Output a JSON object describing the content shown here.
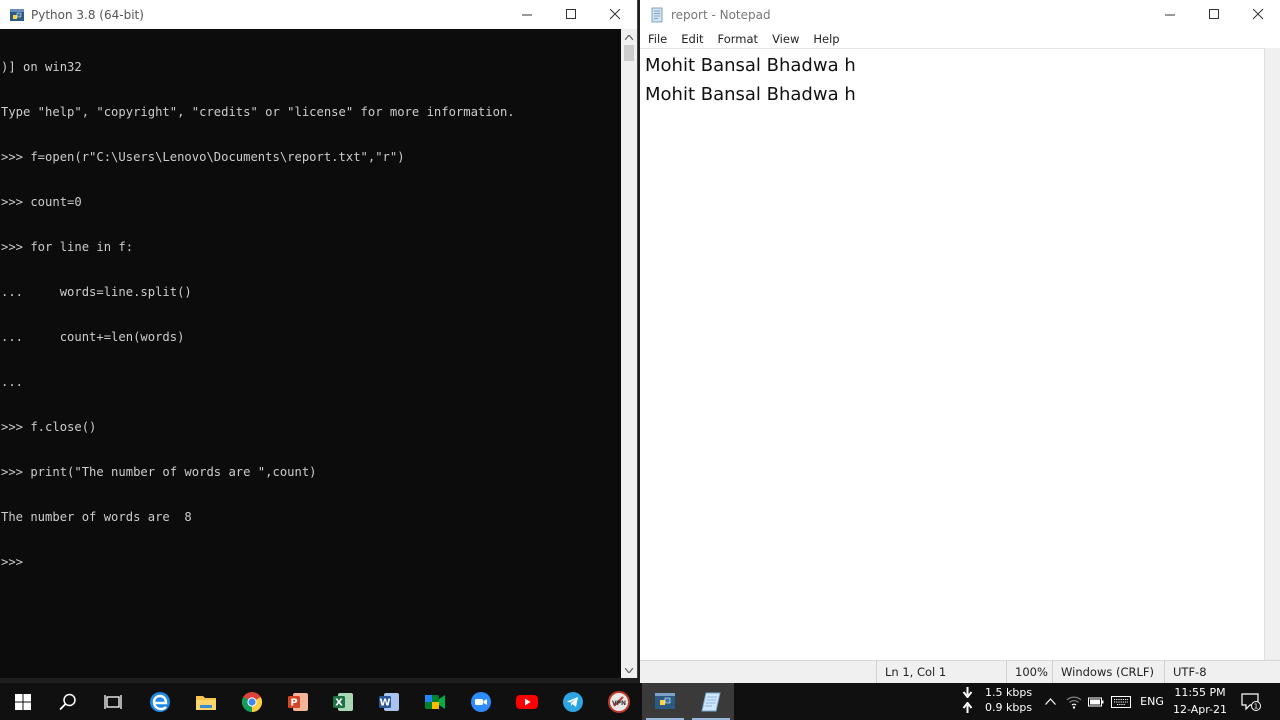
{
  "python_window": {
    "title": "Python 3.8 (64-bit)",
    "console_lines": [
      ")] on win32",
      "Type \"help\", \"copyright\", \"credits\" or \"license\" for more information.",
      ">>> f=open(r\"C:\\Users\\Lenovo\\Documents\\report.txt\",\"r\")",
      ">>> count=0",
      ">>> for line in f:",
      "...     words=line.split()",
      "...     count+=len(words)",
      "...",
      ">>> f.close()",
      ">>> print(\"The number of words are \",count)",
      "The number of words are  8",
      ">>>"
    ]
  },
  "notepad": {
    "title": "report - Notepad",
    "menu": [
      "File",
      "Edit",
      "Format",
      "View",
      "Help"
    ],
    "lines": [
      "Mohit Bansal Bhadwa h",
      "Mohit Bansal Bhadwa h"
    ],
    "status": {
      "position": "Ln 1, Col 1",
      "zoom": "100%",
      "line_ending": "Windows (CRLF)",
      "encoding": "UTF-8"
    }
  },
  "taskbar": {
    "apps": [
      "start-icon",
      "search-icon",
      "task-view-icon",
      "edge-icon",
      "file-explorer-icon",
      "chrome-icon",
      "powerpoint-icon",
      "excel-icon",
      "word-icon",
      "meet-icon",
      "zoom-icon",
      "youtube-icon",
      "telegram-icon",
      "vpn-icon",
      "python-icon",
      "notepad-icon"
    ],
    "net_down": "1.5 kbps",
    "net_up": "0.9 kbps",
    "language": "ENG",
    "time": "11:55 PM",
    "date": "12-Apr-21",
    "notification_count": "1"
  }
}
